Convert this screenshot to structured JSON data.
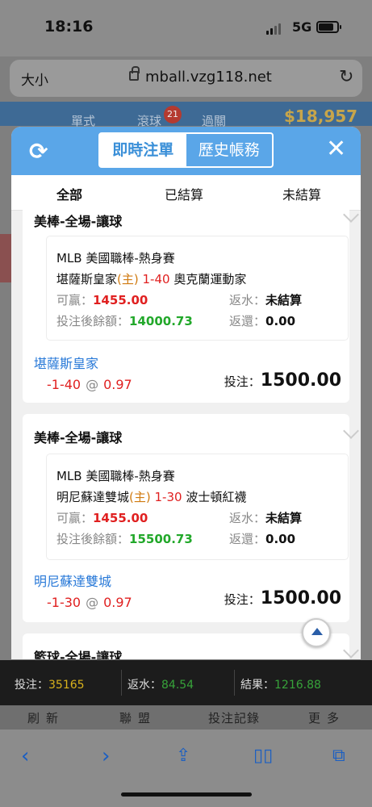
{
  "status": {
    "time": "18:16",
    "network": "5G"
  },
  "browser": {
    "size_label": "大小",
    "url": "mball.vzg118.net"
  },
  "background_page": {
    "tabs": [
      "單式",
      "滾球",
      "過關"
    ],
    "badge": "21",
    "balance": "$18,957"
  },
  "modal": {
    "segments": [
      "即時注單",
      "歷史帳務"
    ],
    "tabs": [
      "全部",
      "已結算",
      "未結算"
    ],
    "bets": [
      {
        "category": "美棒-全場-讓球",
        "league": "MLB 美國職棒-熱身賽",
        "home_team": "堪薩斯皇家",
        "home_mark": "(主)",
        "line": "1-40",
        "away_team": "奧克蘭運動家",
        "win_label": "可贏：",
        "win_value": "1455.00",
        "rebate_label": "返水：",
        "rebate_value": "未結算",
        "balance_label": "投注後餘額：",
        "balance_value": "14000.73",
        "return_label": "返還：",
        "return_value": "0.00",
        "pick": "堪薩斯皇家",
        "handicap": "-1-40",
        "at": "@",
        "odds": "0.97",
        "stake_label": "投注：",
        "stake": "1500.00"
      },
      {
        "category": "美棒-全場-讓球",
        "league": "MLB 美國職棒-熱身賽",
        "home_team": "明尼蘇達雙城",
        "home_mark": "(主)",
        "line": "1-30",
        "away_team": "波士頓紅襪",
        "win_label": "可贏：",
        "win_value": "1455.00",
        "rebate_label": "返水：",
        "rebate_value": "未結算",
        "balance_label": "投注後餘額：",
        "balance_value": "15500.73",
        "return_label": "返還：",
        "return_value": "0.00",
        "pick": "明尼蘇達雙城",
        "handicap": "-1-30",
        "at": "@",
        "odds": "0.97",
        "stake_label": "投注：",
        "stake": "1500.00"
      }
    ],
    "third_category": "籃球-全場-讓球"
  },
  "summary": {
    "bet_label": "投注：",
    "bet_value": "35165",
    "rebate_label": "返水：",
    "rebate_value": "84.54",
    "result_label": "結果：",
    "result_value": "1216.88"
  },
  "bottom_nav": [
    "刷新",
    "聯盟",
    "投注記錄",
    "更多"
  ],
  "colors": {
    "header": "#5aa6e8",
    "red": "#e02020",
    "green": "#22a82a",
    "link": "#2a7ad8"
  }
}
